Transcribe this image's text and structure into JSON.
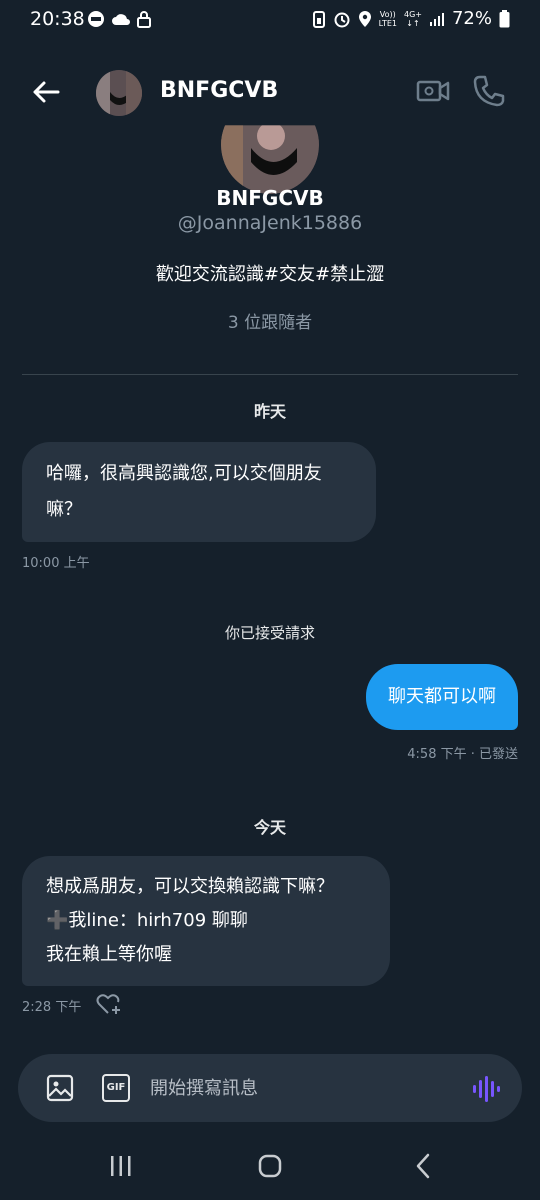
{
  "status_bar": {
    "time": "20:38",
    "volte_top": "Vo))",
    "volte_bottom": "LTE1",
    "network": "4G+",
    "battery": "72%"
  },
  "header": {
    "name": "BNFGCVB"
  },
  "profile": {
    "name": "BNFGCVB",
    "handle": "@JoannaJenk15886",
    "bio": "歡迎交流認識#交友#禁止澀",
    "followers": "3 位跟隨者"
  },
  "conversation": {
    "yesterday_label": "昨天",
    "msg1": {
      "line1": "哈囉，很高興認識您,可以交個朋友",
      "line2": "嘛？",
      "time": "10:00 上午"
    },
    "accepted_label": "你已接受請求",
    "msg2": {
      "text": "聊天都可以啊",
      "meta": "4:58 下午 · 已發送"
    },
    "today_label": "今天",
    "msg3": {
      "line1": "想成爲朋友，可以交換賴認識下嘛？",
      "line2": "➕我line：hirh709 聊聊",
      "line3": "我在賴上等你喔",
      "time": "2:28 下午"
    }
  },
  "compose": {
    "placeholder": "開始撰寫訊息",
    "gif_label": "GIF"
  },
  "colors": {
    "background": "#15202b",
    "incoming_bubble": "#273340",
    "outgoing_bubble": "#1d9bf0",
    "secondary_text": "#8b98a5",
    "voice_accent": "#7856ff"
  }
}
